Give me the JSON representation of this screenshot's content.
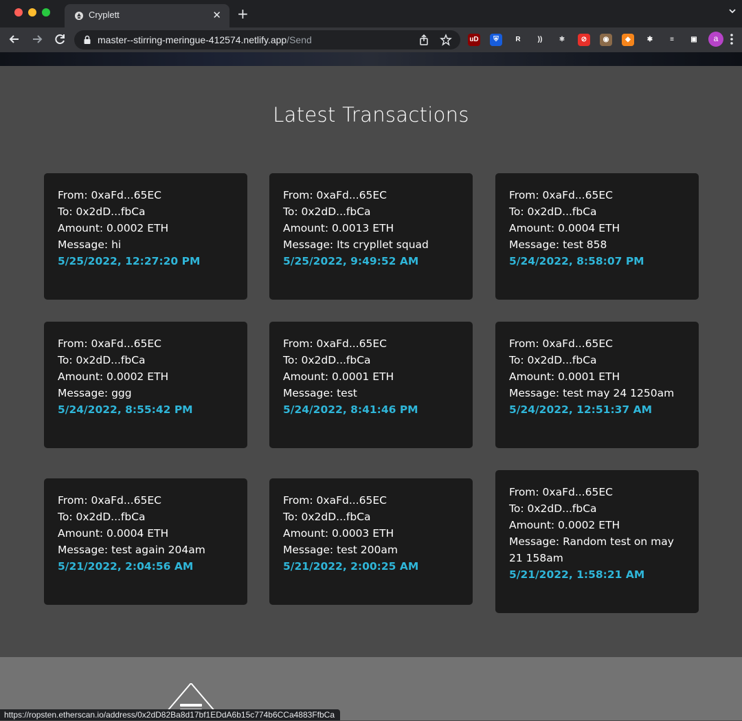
{
  "browser": {
    "tab_title": "Cryplett",
    "tab_close": "✕",
    "new_tab": "+",
    "url_host": "master--stirring-meringue-412574.netlify.app",
    "url_path": "/Send",
    "avatar_letter": "a",
    "status_url": "https://ropsten.etherscan.io/address/0x2dD82Ba8d17bf1EDdA6b15c774b6CCa4883FfbCa",
    "extensions": [
      {
        "name": "ublock-origin-icon",
        "label": "uD",
        "color": "#8b0000"
      },
      {
        "name": "bitwarden-icon",
        "label": "⛨",
        "color": "#175ddc"
      },
      {
        "name": "r-extension-icon",
        "label": "R",
        "color": "#35363a"
      },
      {
        "name": "wireless-icon",
        "label": "))",
        "color": "#35363a"
      },
      {
        "name": "react-devtools-icon",
        "label": "⚛",
        "color": "#35363a"
      },
      {
        "name": "blocker-icon",
        "label": "⊘",
        "color": "#e8302a"
      },
      {
        "name": "owl-icon",
        "label": "◉",
        "color": "#8b6b4a"
      },
      {
        "name": "metamask-icon",
        "label": "◆",
        "color": "#f6851b"
      },
      {
        "name": "extensions-puzzle-icon",
        "label": "✱",
        "color": "#35363a"
      },
      {
        "name": "reading-list-icon",
        "label": "≡",
        "color": "#35363a"
      },
      {
        "name": "side-panel-icon",
        "label": "▣",
        "color": "#35363a"
      }
    ]
  },
  "page": {
    "section_title": "Latest Transactions"
  },
  "transactions": [
    {
      "from": "From: 0xaFd...65EC",
      "to": "To: 0x2dD...fbCa",
      "amount": "Amount: 0.0002 ETH",
      "message": "Message: hi",
      "timestamp": "5/25/2022, 12:27:20 PM"
    },
    {
      "from": "From: 0xaFd...65EC",
      "to": "To: 0x2dD...fbCa",
      "amount": "Amount: 0.0013 ETH",
      "message": "Message: Its crypllet squad",
      "timestamp": "5/25/2022, 9:49:52 AM"
    },
    {
      "from": "From: 0xaFd...65EC",
      "to": "To: 0x2dD...fbCa",
      "amount": "Amount: 0.0004 ETH",
      "message": "Message: test 858",
      "timestamp": "5/24/2022, 8:58:07 PM"
    },
    {
      "from": "From: 0xaFd...65EC",
      "to": "To: 0x2dD...fbCa",
      "amount": "Amount: 0.0002 ETH",
      "message": "Message: ggg",
      "timestamp": "5/24/2022, 8:55:42 PM"
    },
    {
      "from": "From: 0xaFd...65EC",
      "to": "To: 0x2dD...fbCa",
      "amount": "Amount: 0.0001 ETH",
      "message": "Message: test",
      "timestamp": "5/24/2022, 8:41:46 PM"
    },
    {
      "from": "From: 0xaFd...65EC",
      "to": "To: 0x2dD...fbCa",
      "amount": "Amount: 0.0001 ETH",
      "message": "Message: test may 24 1250am",
      "timestamp": "5/24/2022, 12:51:37 AM"
    },
    {
      "from": "From: 0xaFd...65EC",
      "to": "To: 0x2dD...fbCa",
      "amount": "Amount: 0.0004 ETH",
      "message": "Message: test again 204am",
      "timestamp": "5/21/2022, 2:04:56 AM"
    },
    {
      "from": "From: 0xaFd...65EC",
      "to": "To: 0x2dD...fbCa",
      "amount": "Amount: 0.0003 ETH",
      "message": "Message: test 200am",
      "timestamp": "5/21/2022, 2:00:25 AM"
    },
    {
      "from": "From: 0xaFd...65EC",
      "to": "To: 0x2dD...fbCa",
      "amount": "Amount: 0.0002 ETH",
      "message": "Message: Random test on may 21 158am",
      "timestamp": "5/21/2022, 1:58:21 AM"
    }
  ],
  "colors": {
    "page_bg": "#4a4a4a",
    "card_bg": "#1b1b1b",
    "timestamp": "#2fb6d9",
    "footer_bg": "#737373"
  }
}
